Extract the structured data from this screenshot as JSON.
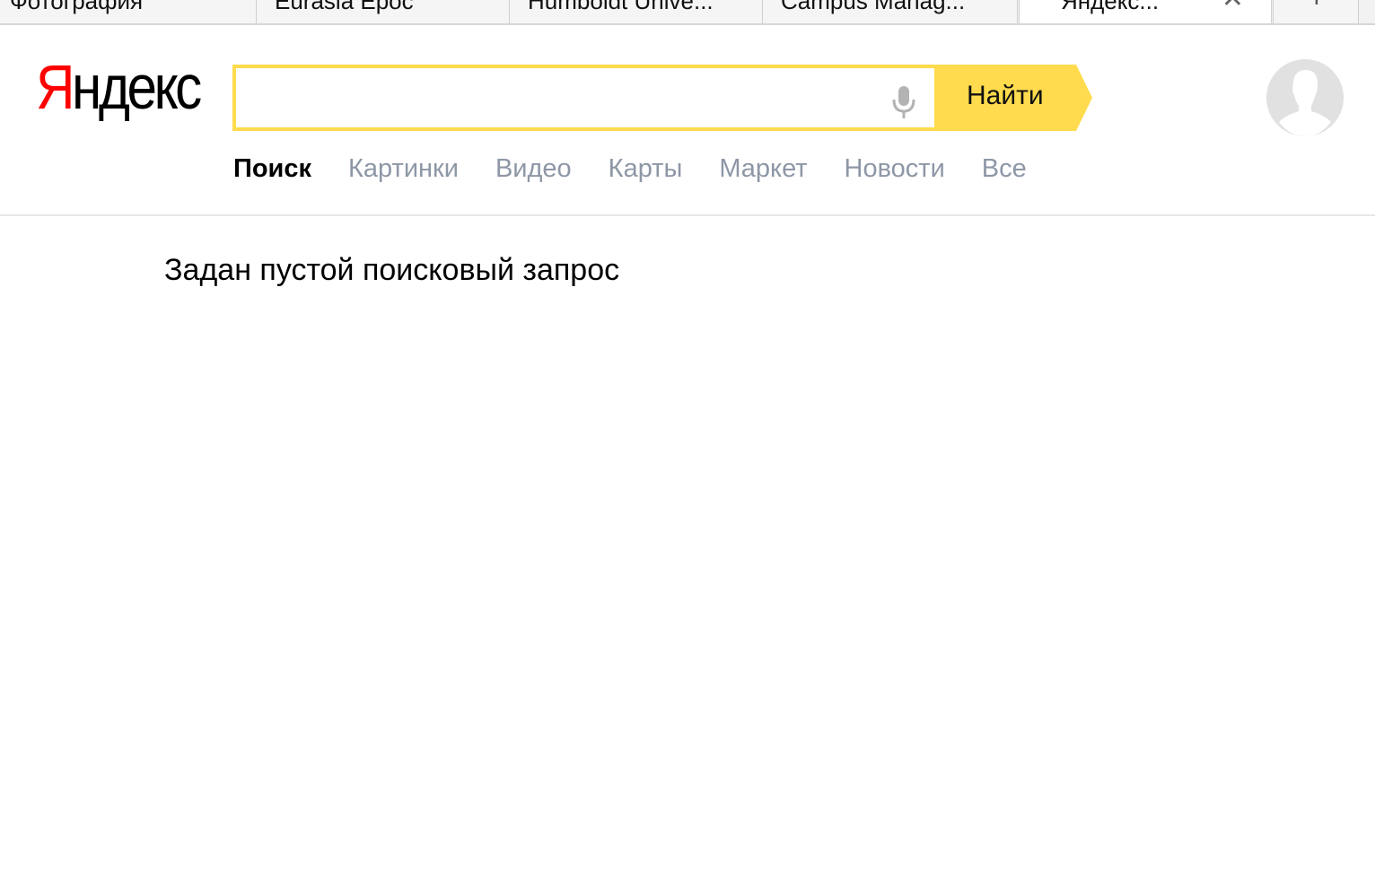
{
  "tabs": [
    {
      "title": "Фотография",
      "active": false
    },
    {
      "title": "Eurasia Epoc",
      "active": false
    },
    {
      "title": "Humboldt Unive...",
      "active": false
    },
    {
      "title": "Campus Manag...",
      "active": false
    },
    {
      "title": "Яндекс...",
      "active": true
    }
  ],
  "tab_close_glyph": "✕",
  "new_tab_glyph": "+",
  "logo": {
    "first_letter": "Я",
    "rest": "ндекс"
  },
  "search": {
    "value": "",
    "placeholder": "",
    "button_label": "Найти"
  },
  "services": [
    {
      "label": "Поиск",
      "active": true
    },
    {
      "label": "Картинки",
      "active": false
    },
    {
      "label": "Видео",
      "active": false
    },
    {
      "label": "Карты",
      "active": false
    },
    {
      "label": "Маркет",
      "active": false
    },
    {
      "label": "Новости",
      "active": false
    },
    {
      "label": "Все",
      "active": false
    }
  ],
  "message": "Задан пустой поисковый запрос",
  "icons": {
    "mic": "microphone-icon",
    "avatar": "user-avatar-icon",
    "close": "close-icon",
    "new_tab": "plus-icon"
  },
  "colors": {
    "logo_accent": "#ff0000",
    "search_yellow": "#ffdb4d",
    "service_inactive": "#8e97a6"
  }
}
